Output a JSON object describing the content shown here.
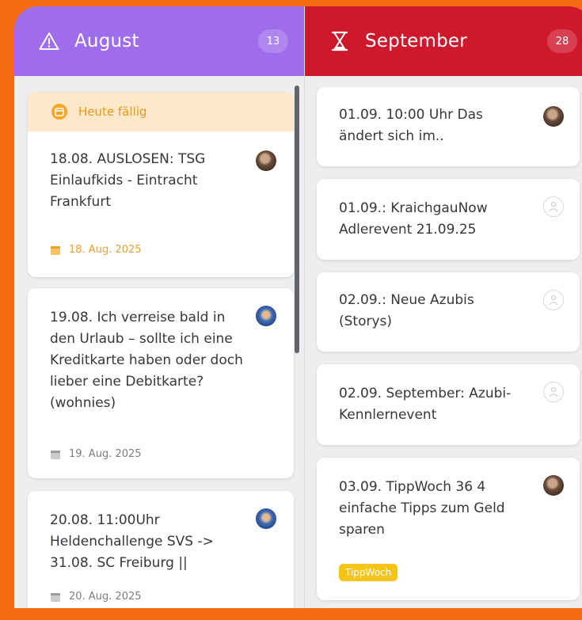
{
  "columns": {
    "august": {
      "title": "August",
      "count": "13",
      "color": "#9f6cec",
      "icon": "warning-triangle-icon",
      "due_banner": "Heute fällig",
      "cards": [
        {
          "text": "18.08. AUSLOSEN: TSG Einlaufkids - Eintracht Frankfurt",
          "date": "18. Aug. 2025",
          "avatar": "photo-avatar"
        },
        {
          "text": "19.08. Ich verreise bald in den Urlaub – sollte ich eine Kreditkarte haben oder doch lieber eine Debitkarte? (wohnies)",
          "date": "19. Aug. 2025",
          "avatar": "photo-avatar-blue"
        },
        {
          "text": "20.08. 11:00Uhr Heldenchallenge SVS -> 31.08. SC Freiburg ||",
          "date": "20. Aug. 2025",
          "avatar": "photo-avatar-blue"
        }
      ]
    },
    "september": {
      "title": "September",
      "count": "28",
      "color": "#d0182c",
      "icon": "hourglass-icon",
      "cards": [
        {
          "text": "01.09. 10:00 Uhr Das ändert sich im..",
          "avatar": "photo-avatar"
        },
        {
          "text": "01.09.: KraichgauNow Adlerevent 21.09.25",
          "avatar": "unassigned-user-icon"
        },
        {
          "text": "02.09.: Neue Azubis (Storys)",
          "avatar": "unassigned-user-icon"
        },
        {
          "text": "02.09. September: Azubi-Kennlernevent",
          "avatar": "unassigned-user-icon"
        },
        {
          "text": "03.09. TippWoch 36 4 einfache Tipps zum Geld sparen",
          "avatar": "photo-avatar",
          "tag": "TippWoch"
        }
      ]
    }
  },
  "colors": {
    "background": "#f36a12",
    "due_text": "#e89a1c",
    "due_bg": "#fde8c9",
    "tag": "#f5c418"
  }
}
